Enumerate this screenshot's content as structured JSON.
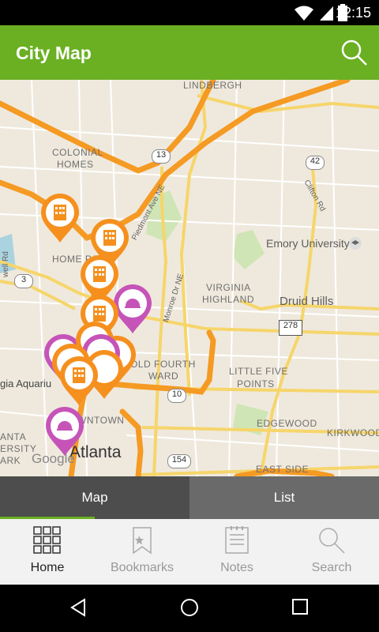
{
  "status_bar": {
    "time": "12:15"
  },
  "app_bar": {
    "title": "City Map"
  },
  "map": {
    "labels": {
      "lindbergh": "LINDBERGH",
      "colonial_homes_1": "COLONIAL",
      "colonial_homes_2": "HOMES",
      "home_park": "HOME PA",
      "piedmont_ave": "Piedmont Ave NE",
      "monroe_dr": "Monroe Dr NE",
      "virginia_highland_1": "VIRGINIA",
      "virginia_highland_2": "HIGHLAND",
      "emory": "Emory University",
      "druid_hills": "Druid Hills",
      "clifton": "Clifton Rd",
      "old_fourth_ward_1": "OLD FOURTH",
      "old_fourth_ward_2": "WARD",
      "little_five_points_1": "LITTLE FIVE",
      "little_five_points_2": "POINTS",
      "edgewood": "EDGEWOOD",
      "kirkwood": "KIRKWOOD",
      "aquarium": "gia Aquariu",
      "downtown": "WNTOWN",
      "atlanta": "Atlanta",
      "east_side": "EAST SIDE",
      "anta": "ANTA",
      "ersity": "ERSITY",
      "ark": "ARK",
      "well_rd": "well Rd"
    },
    "shields": {
      "r13": "13",
      "r42": "42",
      "r3": "3",
      "r278": "278",
      "r10": "10",
      "r154": "154"
    },
    "google_watermark": "Google"
  },
  "tabs": {
    "map": "Map",
    "list": "List"
  },
  "bottom_nav": [
    {
      "label": "Home",
      "icon": "grid-icon",
      "active": true
    },
    {
      "label": "Bookmarks",
      "icon": "bookmark-icon",
      "active": false
    },
    {
      "label": "Notes",
      "icon": "notes-icon",
      "active": false
    },
    {
      "label": "Search",
      "icon": "search-icon",
      "active": false
    }
  ],
  "colors": {
    "accent": "#6ab022",
    "hotel_pin": "#f5901e",
    "restaurant_pin": "#c654b8"
  }
}
